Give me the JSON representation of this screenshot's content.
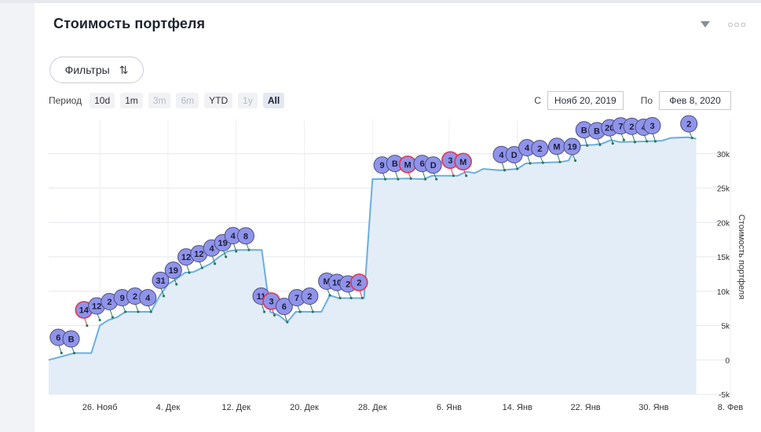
{
  "header": {
    "title": "Стоимость портфеля"
  },
  "filters": {
    "label": "Фильтры"
  },
  "period": {
    "label": "Период",
    "buttons": [
      {
        "label": "10d",
        "state": "normal"
      },
      {
        "label": "1m",
        "state": "normal"
      },
      {
        "label": "3m",
        "state": "disabled"
      },
      {
        "label": "6m",
        "state": "disabled"
      },
      {
        "label": "YTD",
        "state": "normal"
      },
      {
        "label": "1y",
        "state": "disabled"
      },
      {
        "label": "All",
        "state": "active"
      }
    ]
  },
  "range": {
    "from_label": "С",
    "from_value": "Нояб 20, 2019",
    "to_label": "По",
    "to_value": "Фев 8, 2020"
  },
  "colors": {
    "line": "#6aaee0",
    "area": "#e3edf8",
    "marker": "#8f93ea",
    "marker_red": "#e5334b",
    "connector": "#2c7a5a"
  },
  "chart_data": {
    "type": "area",
    "ylabel": "Стоимость портфеля",
    "ylim": [
      -5000,
      35000
    ],
    "y_ticks": [
      -5000,
      0,
      5000,
      10000,
      15000,
      20000,
      25000,
      30000
    ],
    "y_tick_labels": [
      "-5k",
      "0",
      "5k",
      "10k",
      "15k",
      "20k",
      "25k",
      "30k"
    ],
    "x_ticks": [
      "26. Нояб",
      "4. Дек",
      "12. Дек",
      "20. Дек",
      "28. Дек",
      "6. Янв",
      "14. Янв",
      "22. Янв",
      "30. Янв",
      "8. Фев"
    ],
    "x_tick_days": [
      6,
      14,
      22,
      30,
      38,
      47,
      55,
      63,
      71,
      80
    ],
    "xlim_days": [
      0,
      80
    ],
    "x_origin_date": "2019-11-20",
    "series": [
      {
        "points": [
          [
            0,
            0
          ],
          [
            3,
            1000
          ],
          [
            4,
            1000
          ],
          [
            5,
            1000
          ],
          [
            6,
            5000
          ],
          [
            7,
            5800
          ],
          [
            8,
            6200
          ],
          [
            9,
            7000
          ],
          [
            10,
            7000
          ],
          [
            11,
            7000
          ],
          [
            12,
            7000
          ],
          [
            13,
            9300
          ],
          [
            14,
            11000
          ],
          [
            15,
            11800
          ],
          [
            16,
            12700
          ],
          [
            17,
            12800
          ],
          [
            18,
            13400
          ],
          [
            19,
            14000
          ],
          [
            20,
            15000
          ],
          [
            21,
            15800
          ],
          [
            22,
            16000
          ],
          [
            25,
            16000
          ],
          [
            26,
            7000
          ],
          [
            27,
            6500
          ],
          [
            28,
            5500
          ],
          [
            29,
            7000
          ],
          [
            32,
            7000
          ],
          [
            33,
            9400
          ],
          [
            34,
            9000
          ],
          [
            35,
            9000
          ],
          [
            37,
            9000
          ],
          [
            38,
            26300
          ],
          [
            42,
            26400
          ],
          [
            44,
            26300
          ],
          [
            45,
            26800
          ],
          [
            46,
            26800
          ],
          [
            48,
            26800
          ],
          [
            49,
            27400
          ],
          [
            50,
            27200
          ],
          [
            51,
            27800
          ],
          [
            53,
            27600
          ],
          [
            55,
            27800
          ],
          [
            56,
            28600
          ],
          [
            58,
            28700
          ],
          [
            60,
            28800
          ],
          [
            61,
            29000
          ],
          [
            62,
            31200
          ],
          [
            64,
            31300
          ],
          [
            65,
            31500
          ],
          [
            66,
            32000
          ],
          [
            67,
            31700
          ],
          [
            70,
            31800
          ],
          [
            72,
            31900
          ],
          [
            73,
            32300
          ],
          [
            75,
            32400
          ],
          [
            76,
            32200
          ]
        ]
      }
    ],
    "markers": [
      {
        "label": "6",
        "day": 1.5,
        "value": 1000,
        "red": false
      },
      {
        "label": "B",
        "day": 3.0,
        "value": 1000,
        "red": false
      },
      {
        "label": "14",
        "day": 4.5,
        "value": 5000,
        "red": true
      },
      {
        "label": "12",
        "day": 6.0,
        "value": 5800,
        "red": false
      },
      {
        "label": "2",
        "day": 7.5,
        "value": 6200,
        "red": false
      },
      {
        "label": "9",
        "day": 9.0,
        "value": 7000,
        "red": false
      },
      {
        "label": "2",
        "day": 10.5,
        "value": 7000,
        "red": false
      },
      {
        "label": "4",
        "day": 12.0,
        "value": 7000,
        "red": false
      },
      {
        "label": "31",
        "day": 13.5,
        "value": 9300,
        "red": false
      },
      {
        "label": "19",
        "day": 15.0,
        "value": 11000,
        "red": false
      },
      {
        "label": "12",
        "day": 16.5,
        "value": 12700,
        "red": false
      },
      {
        "label": "12",
        "day": 18.0,
        "value": 13400,
        "red": false
      },
      {
        "label": "4",
        "day": 19.5,
        "value": 14000,
        "red": false
      },
      {
        "label": "19",
        "day": 20.8,
        "value": 15000,
        "red": false
      },
      {
        "label": "4",
        "day": 22.0,
        "value": 15800,
        "red": false
      },
      {
        "label": "8",
        "day": 23.5,
        "value": 16000,
        "red": false
      },
      {
        "label": "11",
        "day": 25.3,
        "value": 7000,
        "red": false
      },
      {
        "label": "3",
        "day": 26.5,
        "value": 6500,
        "red": true
      },
      {
        "label": "6",
        "day": 28.0,
        "value": 5500,
        "red": false
      },
      {
        "label": "7",
        "day": 29.5,
        "value": 7000,
        "red": false
      },
      {
        "label": "2",
        "day": 31.0,
        "value": 7000,
        "red": false
      },
      {
        "label": "M",
        "day": 33.0,
        "value": 9400,
        "red": false
      },
      {
        "label": "10",
        "day": 34.2,
        "value": 9000,
        "red": false
      },
      {
        "label": "2",
        "day": 35.5,
        "value": 9000,
        "red": false
      },
      {
        "label": "2",
        "day": 36.8,
        "value": 9000,
        "red": true
      },
      {
        "label": "9",
        "day": 39.5,
        "value": 26300,
        "red": false
      },
      {
        "label": "B",
        "day": 41.0,
        "value": 26300,
        "red": false
      },
      {
        "label": "M",
        "day": 42.5,
        "value": 26400,
        "red": true
      },
      {
        "label": "6",
        "day": 44.2,
        "value": 26300,
        "red": false
      },
      {
        "label": "D",
        "day": 45.5,
        "value": 26300,
        "red": false
      },
      {
        "label": "3",
        "day": 47.5,
        "value": 26800,
        "red": true
      },
      {
        "label": "M",
        "day": 49.0,
        "value": 26800,
        "red": true
      },
      {
        "label": "4",
        "day": 53.5,
        "value": 27600,
        "red": false
      },
      {
        "label": "D",
        "day": 55.0,
        "value": 27800,
        "red": false
      },
      {
        "label": "4",
        "day": 56.5,
        "value": 28600,
        "red": false
      },
      {
        "label": "2",
        "day": 58.0,
        "value": 28700,
        "red": false
      },
      {
        "label": "M",
        "day": 60.0,
        "value": 28800,
        "red": false
      },
      {
        "label": "19",
        "day": 61.8,
        "value": 29000,
        "red": false
      },
      {
        "label": "B",
        "day": 63.2,
        "value": 31200,
        "red": false
      },
      {
        "label": "B",
        "day": 64.7,
        "value": 31300,
        "red": false
      },
      {
        "label": "20",
        "day": 66.2,
        "value": 31500,
        "red": false
      },
      {
        "label": "7",
        "day": 67.5,
        "value": 32000,
        "red": false
      },
      {
        "label": "2",
        "day": 68.8,
        "value": 31700,
        "red": false
      },
      {
        "label": "4",
        "day": 70.2,
        "value": 31800,
        "red": false
      },
      {
        "label": "3",
        "day": 71.2,
        "value": 31800,
        "red": false
      },
      {
        "label": "2",
        "day": 75.5,
        "value": 32300,
        "red": false
      }
    ]
  }
}
